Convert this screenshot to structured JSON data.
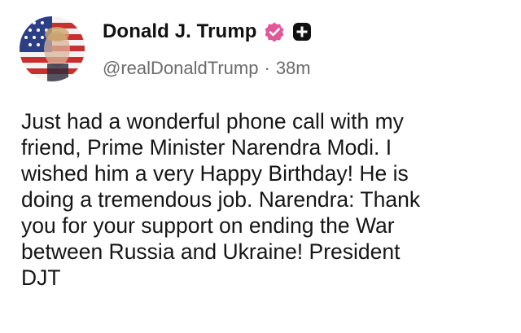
{
  "author": {
    "display_name": "Donald J. Trump",
    "handle": "@realDonaldTrump",
    "separator": "·",
    "time_ago": "38m"
  },
  "badges": {
    "verified_color": "#e0589a",
    "plus_color": "#111111"
  },
  "post": {
    "text": "Just had a wonderful phone call with my\nfriend, Prime Minister Narendra Modi. I\nwished him a very Happy Birthday! He is\ndoing a tremendous job. Narendra: Thank\nyou for your support on ending the War\nbetween Russia and Ukraine! President\nDJT"
  }
}
